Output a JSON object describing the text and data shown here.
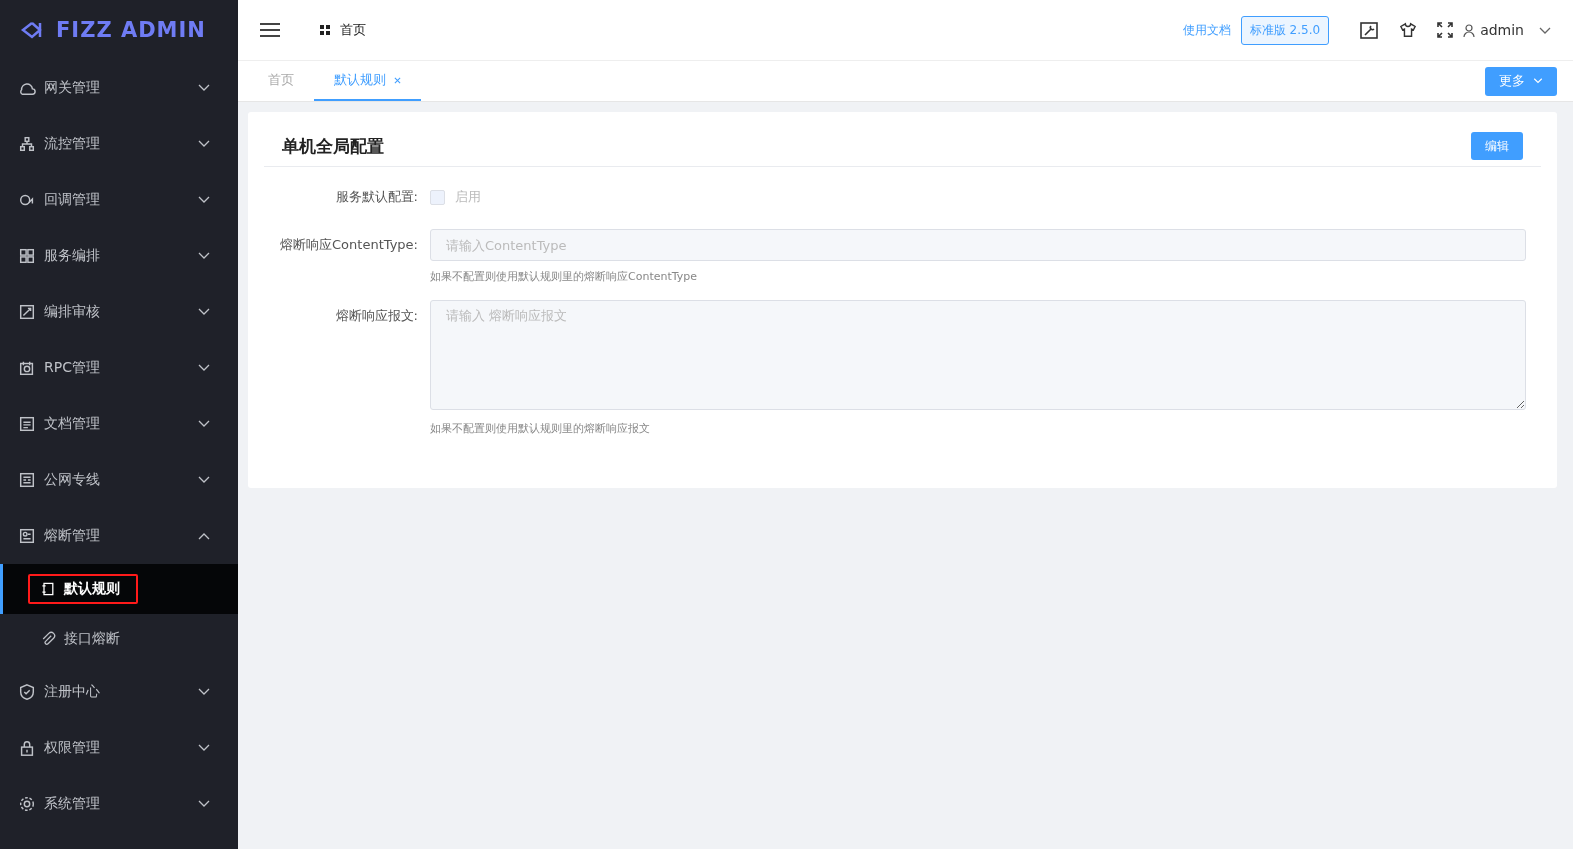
{
  "sidebar": {
    "logo": "FIZZ ADMIN",
    "items": [
      {
        "label": "网关管理",
        "expanded": false
      },
      {
        "label": "流控管理",
        "expanded": false
      },
      {
        "label": "回调管理",
        "expanded": false
      },
      {
        "label": "服务编排",
        "expanded": false
      },
      {
        "label": "编排审核",
        "expanded": false
      },
      {
        "label": "RPC管理",
        "expanded": false
      },
      {
        "label": "文档管理",
        "expanded": false
      },
      {
        "label": "公网专线",
        "expanded": false
      },
      {
        "label": "熔断管理",
        "expanded": true,
        "children": [
          {
            "label": "默认规则",
            "selected": true,
            "highlighted": true
          },
          {
            "label": "接口熔断",
            "selected": false,
            "highlighted": false
          }
        ]
      },
      {
        "label": "注册中心",
        "expanded": false
      },
      {
        "label": "权限管理",
        "expanded": false
      },
      {
        "label": "系统管理",
        "expanded": false
      }
    ]
  },
  "header": {
    "breadcrumb": "首页",
    "docs_link": "使用文档",
    "version": "标准版 2.5.0",
    "user": "admin"
  },
  "tabs": [
    {
      "label": "首页",
      "selected": false,
      "closable": false
    },
    {
      "label": "默认规则",
      "selected": true,
      "closable": true
    }
  ],
  "more_button": "更多",
  "card": {
    "title": "单机全局配置",
    "edit_button": "编辑",
    "fields": [
      {
        "kind": "checkbox",
        "label": "服务默认配置:",
        "option": "启用",
        "checked": false,
        "disabled": true
      },
      {
        "kind": "input",
        "label": "熔断响应ContentType:",
        "placeholder": "请输入ContentType",
        "hint": "如果不配置则使用默认规则里的熔断响应ContentType"
      },
      {
        "kind": "textarea",
        "label": "熔断响应报文:",
        "placeholder": "请输入 熔断响应报文",
        "hint": "如果不配置则使用默认规则里的熔断响应报文"
      }
    ]
  }
}
